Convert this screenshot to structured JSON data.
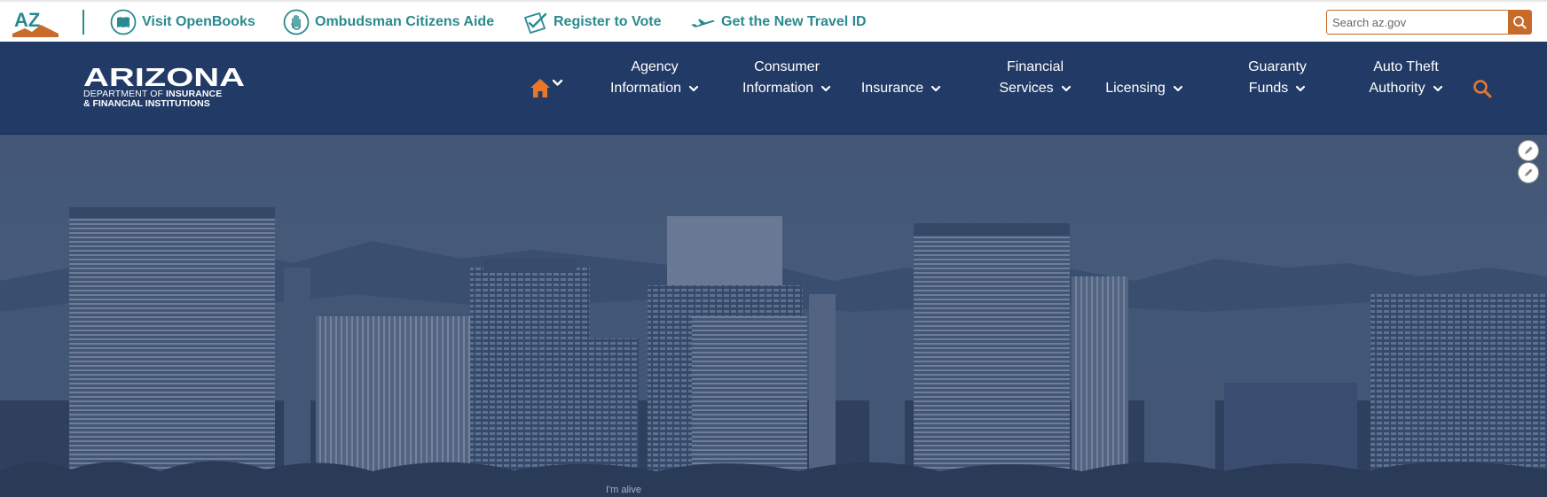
{
  "topbar": {
    "logo_text": "AZ",
    "links": [
      {
        "label": "Visit OpenBooks",
        "icon": "open-book-icon"
      },
      {
        "label": "Ombudsman Citizens Aide",
        "icon": "raised-hand-icon"
      },
      {
        "label": "Register to Vote",
        "icon": "ballot-check-icon"
      },
      {
        "label": "Get the New Travel ID",
        "icon": "airplane-icon"
      }
    ],
    "search": {
      "placeholder": "Search az.gov",
      "value": ""
    }
  },
  "navbar": {
    "brand": {
      "title": "ARIZONA",
      "line1_prefix": "DEPARTMENT OF ",
      "line1_bold": "INSURANCE",
      "line2": "& FINANCIAL INSTITUTIONS"
    },
    "items": [
      {
        "line1": "Agency",
        "line2": "Information"
      },
      {
        "line1": "Consumer",
        "line2": "Information"
      },
      {
        "line1": "",
        "line2": "Insurance"
      },
      {
        "line1": "Financial",
        "line2": "Services"
      },
      {
        "line1": "",
        "line2": "Licensing"
      },
      {
        "line1": "Guaranty",
        "line2": "Funds"
      },
      {
        "line1": "Auto Theft",
        "line2": "Authority"
      }
    ]
  },
  "colors": {
    "teal": "#2a8a8f",
    "orange": "#e8772e",
    "navy": "#223a66",
    "hero_overlay": "#2b4470"
  },
  "hero": {
    "signage": "I'm alive"
  }
}
